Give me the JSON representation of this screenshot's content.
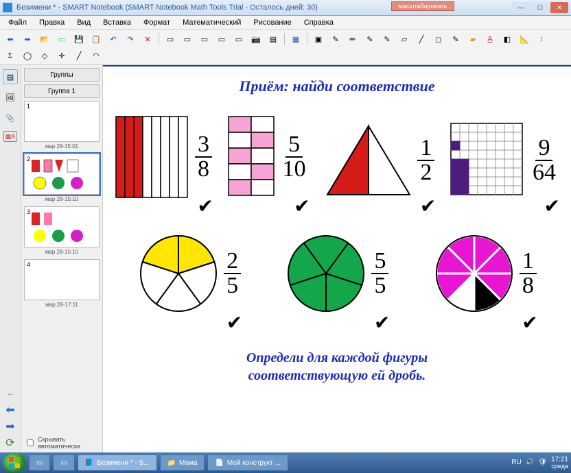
{
  "window": {
    "title": "Безимени * - SMART Notebook (SMART Notebook Math Tools Trial - Осталось дней: 30)",
    "float_tag": "масштабировать"
  },
  "menu": [
    "Файл",
    "Правка",
    "Вид",
    "Вставка",
    "Формат",
    "Математический",
    "Рисование",
    "Справка"
  ],
  "sidebar": {
    "groups_btn": "Группы",
    "group1_btn": "Группа 1",
    "thumbs": [
      {
        "num": "1",
        "label": "мар 28-15:01"
      },
      {
        "num": "2",
        "label": "мар 28-15:10"
      },
      {
        "num": "3",
        "label": "мар 28-15:10"
      },
      {
        "num": "4",
        "label": "мар 28-17:11"
      }
    ],
    "autohide": "Скрывать автоматически"
  },
  "page": {
    "title": "Приём: найди соответствие",
    "instruction_l1": "Определи для каждой фигуры",
    "instruction_l2": "соответствующую ей дробь.",
    "items": [
      {
        "num": "3",
        "den": "8"
      },
      {
        "num": "5",
        "den": "10"
      },
      {
        "num": "1",
        "den": "2"
      },
      {
        "num": "9",
        "den": "64"
      },
      {
        "num": "2",
        "den": "5"
      },
      {
        "num": "5",
        "den": "5"
      },
      {
        "num": "1",
        "den": "8"
      }
    ]
  },
  "taskbar": {
    "items": [
      "Безимени * - S...",
      "Мама",
      "Мой конструкт ..."
    ],
    "time": "17:21",
    "day": "среда",
    "lang": "RU"
  }
}
